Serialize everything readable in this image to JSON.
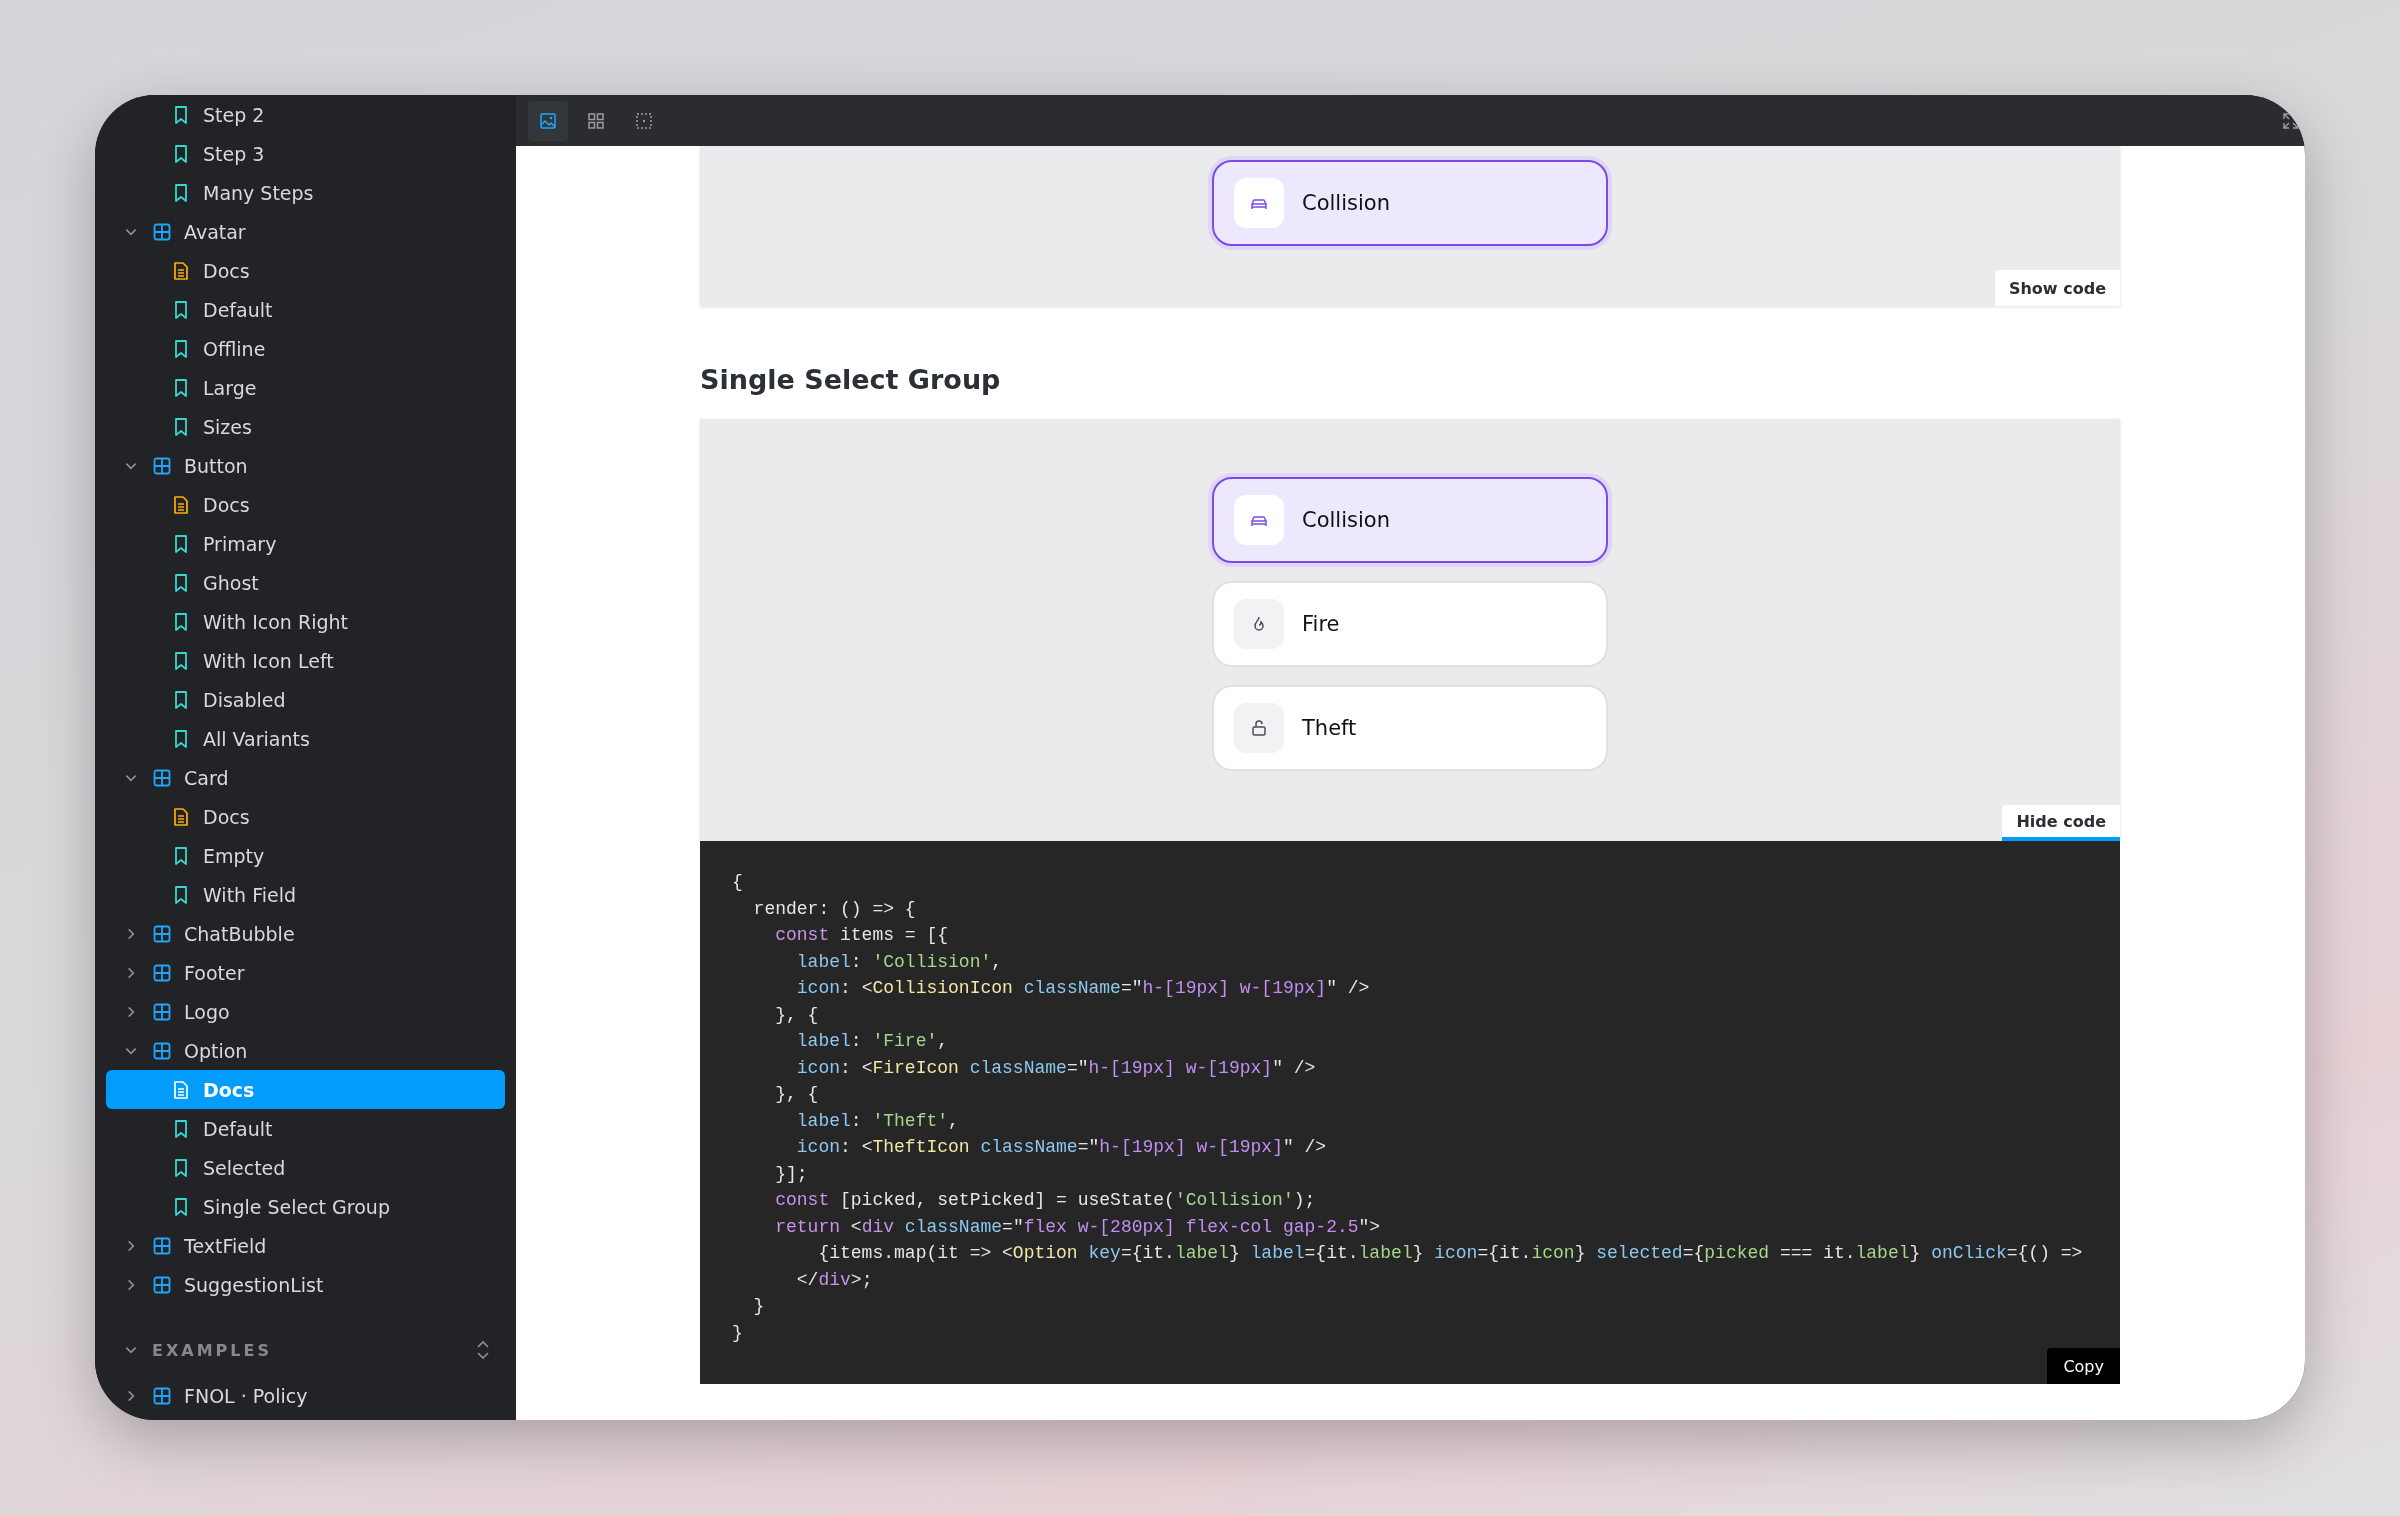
{
  "sidebar": {
    "leading_items": [
      {
        "label": "Step 2",
        "kind": "story",
        "selected": false
      },
      {
        "label": "Step 3",
        "kind": "story",
        "selected": false
      },
      {
        "label": "Many Steps",
        "kind": "story",
        "selected": false
      }
    ],
    "components": [
      {
        "label": "Avatar",
        "expanded": true,
        "children": [
          {
            "label": "Docs",
            "kind": "docs",
            "selected": false
          },
          {
            "label": "Default",
            "kind": "story",
            "selected": false
          },
          {
            "label": "Offline",
            "kind": "story",
            "selected": false
          },
          {
            "label": "Large",
            "kind": "story",
            "selected": false
          },
          {
            "label": "Sizes",
            "kind": "story",
            "selected": false
          }
        ]
      },
      {
        "label": "Button",
        "expanded": true,
        "children": [
          {
            "label": "Docs",
            "kind": "docs",
            "selected": false
          },
          {
            "label": "Primary",
            "kind": "story",
            "selected": false
          },
          {
            "label": "Ghost",
            "kind": "story",
            "selected": false
          },
          {
            "label": "With Icon Right",
            "kind": "story",
            "selected": false
          },
          {
            "label": "With Icon Left",
            "kind": "story",
            "selected": false
          },
          {
            "label": "Disabled",
            "kind": "story",
            "selected": false
          },
          {
            "label": "All Variants",
            "kind": "story",
            "selected": false
          }
        ]
      },
      {
        "label": "Card",
        "expanded": true,
        "children": [
          {
            "label": "Docs",
            "kind": "docs",
            "selected": false
          },
          {
            "label": "Empty",
            "kind": "story",
            "selected": false
          },
          {
            "label": "With Field",
            "kind": "story",
            "selected": false
          }
        ]
      },
      {
        "label": "ChatBubble",
        "expanded": false
      },
      {
        "label": "Footer",
        "expanded": false
      },
      {
        "label": "Logo",
        "expanded": false
      },
      {
        "label": "Option",
        "expanded": true,
        "children": [
          {
            "label": "Docs",
            "kind": "docs",
            "selected": true
          },
          {
            "label": "Default",
            "kind": "story",
            "selected": false
          },
          {
            "label": "Selected",
            "kind": "story",
            "selected": false
          },
          {
            "label": "Single Select Group",
            "kind": "story",
            "selected": false
          }
        ]
      },
      {
        "label": "TextField",
        "expanded": false
      },
      {
        "label": "SuggestionList",
        "expanded": false
      }
    ],
    "examples_section": {
      "label": "EXAMPLES",
      "expanded": true
    },
    "examples": [
      {
        "label": "FNOL · Policy",
        "expanded": false
      }
    ]
  },
  "toolbar": {
    "tools": [
      {
        "kind": "image",
        "selected": true
      },
      {
        "kind": "grid",
        "selected": false
      },
      {
        "kind": "outline",
        "selected": false
      }
    ]
  },
  "top_preview": {
    "options": [
      {
        "label": "Collision",
        "kind": "car",
        "selected": true
      }
    ],
    "code_toggle": "Show code"
  },
  "section": {
    "heading": "Single Select Group",
    "options": [
      {
        "label": "Collision",
        "kind": "car",
        "selected": true
      },
      {
        "label": "Fire",
        "kind": "fire",
        "selected": false
      },
      {
        "label": "Theft",
        "kind": "lock",
        "selected": false
      }
    ],
    "code_toggle": "Hide code",
    "code_shown": true,
    "code_lines": [
      [
        {
          "kind": "p",
          "text": "{"
        }
      ],
      [
        {
          "kind": "p",
          "text": "  render: () => {"
        }
      ],
      [
        {
          "kind": "kw",
          "text": "    const"
        },
        {
          "kind": "p",
          "text": " items = [{"
        }
      ],
      [
        {
          "kind": "prop",
          "text": "      label"
        },
        {
          "kind": "p",
          "text": ": "
        },
        {
          "kind": "str",
          "text": "'Collision'"
        },
        {
          "kind": "p",
          "text": ","
        }
      ],
      [
        {
          "kind": "prop",
          "text": "      icon"
        },
        {
          "kind": "p",
          "text": ": <"
        },
        {
          "kind": "tag",
          "text": "CollisionIcon"
        },
        {
          "kind": "prop",
          "text": " className"
        },
        {
          "kind": "p",
          "text": "=\""
        },
        {
          "kind": "cls",
          "text": "h-[19px] w-[19px]"
        },
        {
          "kind": "p",
          "text": "\" />"
        }
      ],
      [
        {
          "kind": "p",
          "text": "    }, {"
        }
      ],
      [
        {
          "kind": "prop",
          "text": "      label"
        },
        {
          "kind": "p",
          "text": ": "
        },
        {
          "kind": "str",
          "text": "'Fire'"
        },
        {
          "kind": "p",
          "text": ","
        }
      ],
      [
        {
          "kind": "prop",
          "text": "      icon"
        },
        {
          "kind": "p",
          "text": ": <"
        },
        {
          "kind": "tag",
          "text": "FireIcon"
        },
        {
          "kind": "prop",
          "text": " className"
        },
        {
          "kind": "p",
          "text": "=\""
        },
        {
          "kind": "cls",
          "text": "h-[19px] w-[19px]"
        },
        {
          "kind": "p",
          "text": "\" />"
        }
      ],
      [
        {
          "kind": "p",
          "text": "    }, {"
        }
      ],
      [
        {
          "kind": "prop",
          "text": "      label"
        },
        {
          "kind": "p",
          "text": ": "
        },
        {
          "kind": "str",
          "text": "'Theft'"
        },
        {
          "kind": "p",
          "text": ","
        }
      ],
      [
        {
          "kind": "prop",
          "text": "      icon"
        },
        {
          "kind": "p",
          "text": ": <"
        },
        {
          "kind": "tag",
          "text": "TheftIcon"
        },
        {
          "kind": "prop",
          "text": " className"
        },
        {
          "kind": "p",
          "text": "=\""
        },
        {
          "kind": "cls",
          "text": "h-[19px] w-[19px]"
        },
        {
          "kind": "p",
          "text": "\" />"
        }
      ],
      [
        {
          "kind": "p",
          "text": "    }];"
        }
      ],
      [
        {
          "kind": "kw",
          "text": "    const"
        },
        {
          "kind": "p",
          "text": " [picked, setPicked] = useState("
        },
        {
          "kind": "str",
          "text": "'Collision'"
        },
        {
          "kind": "p",
          "text": ");"
        }
      ],
      [
        {
          "kind": "kw",
          "text": "    return"
        },
        {
          "kind": "p",
          "text": " <"
        },
        {
          "kind": "kw",
          "text": "div"
        },
        {
          "kind": "prop",
          "text": " className"
        },
        {
          "kind": "p",
          "text": "=\""
        },
        {
          "kind": "cls",
          "text": "flex w-[280px] flex-col gap-2.5"
        },
        {
          "kind": "p",
          "text": "\">"
        }
      ],
      [
        {
          "kind": "p",
          "text": "        {items.map(it => <"
        },
        {
          "kind": "tag",
          "text": "Option"
        },
        {
          "kind": "prop",
          "text": " key"
        },
        {
          "kind": "p",
          "text": "={it."
        },
        {
          "kind": "str",
          "text": "label"
        },
        {
          "kind": "p",
          "text": "} "
        },
        {
          "kind": "prop",
          "text": "label"
        },
        {
          "kind": "p",
          "text": "={it."
        },
        {
          "kind": "str",
          "text": "label"
        },
        {
          "kind": "p",
          "text": "} "
        },
        {
          "kind": "prop",
          "text": "icon"
        },
        {
          "kind": "p",
          "text": "={it."
        },
        {
          "kind": "str",
          "text": "icon"
        },
        {
          "kind": "p",
          "text": "} "
        },
        {
          "kind": "prop",
          "text": "selected"
        },
        {
          "kind": "p",
          "text": "={"
        },
        {
          "kind": "str",
          "text": "picked"
        },
        {
          "kind": "p",
          "text": " === it."
        },
        {
          "kind": "str",
          "text": "label"
        },
        {
          "kind": "p",
          "text": "} "
        },
        {
          "kind": "prop",
          "text": "onClick"
        },
        {
          "kind": "p",
          "text": "={() =>"
        }
      ],
      [
        {
          "kind": "p",
          "text": "      </"
        },
        {
          "kind": "kw",
          "text": "div"
        },
        {
          "kind": "p",
          "text": ">;"
        }
      ],
      [
        {
          "kind": "p",
          "text": "  }"
        }
      ],
      [
        {
          "kind": "p",
          "text": "}"
        }
      ]
    ],
    "copy_button": "Copy"
  }
}
